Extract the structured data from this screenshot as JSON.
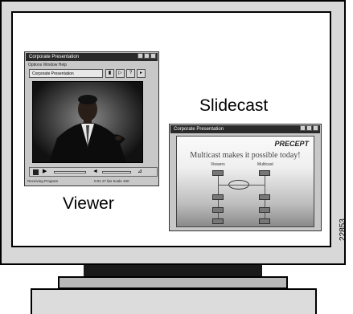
{
  "labels": {
    "viewer": "Viewer",
    "slidecast": "Slidecast",
    "figure_number": "22853"
  },
  "viewer_window": {
    "title": "Corporate Presentation",
    "menu": "Options  Window  Help",
    "combo_value": "Corporate Presentation",
    "status_left": "Receiving Program",
    "status_right": "0:01    27 fps    Scale 100"
  },
  "slidecast_window": {
    "title": "Corporate Presentation",
    "slide_logo": "PRECEPT",
    "slide_headline": "Multicast makes it possible today!",
    "col1": "Viewers",
    "col2": "Multicast"
  },
  "icons": {
    "close": "close-icon",
    "minimize": "minimize-icon",
    "maximize": "maximize-icon",
    "stop": "stop-icon",
    "play": "play-icon",
    "volume": "volume-icon"
  },
  "colors": {
    "bezel": "#d8d8d8",
    "screen": "#ffffff",
    "window": "#c8c8c8",
    "titlebar": "#2a2a2a"
  }
}
